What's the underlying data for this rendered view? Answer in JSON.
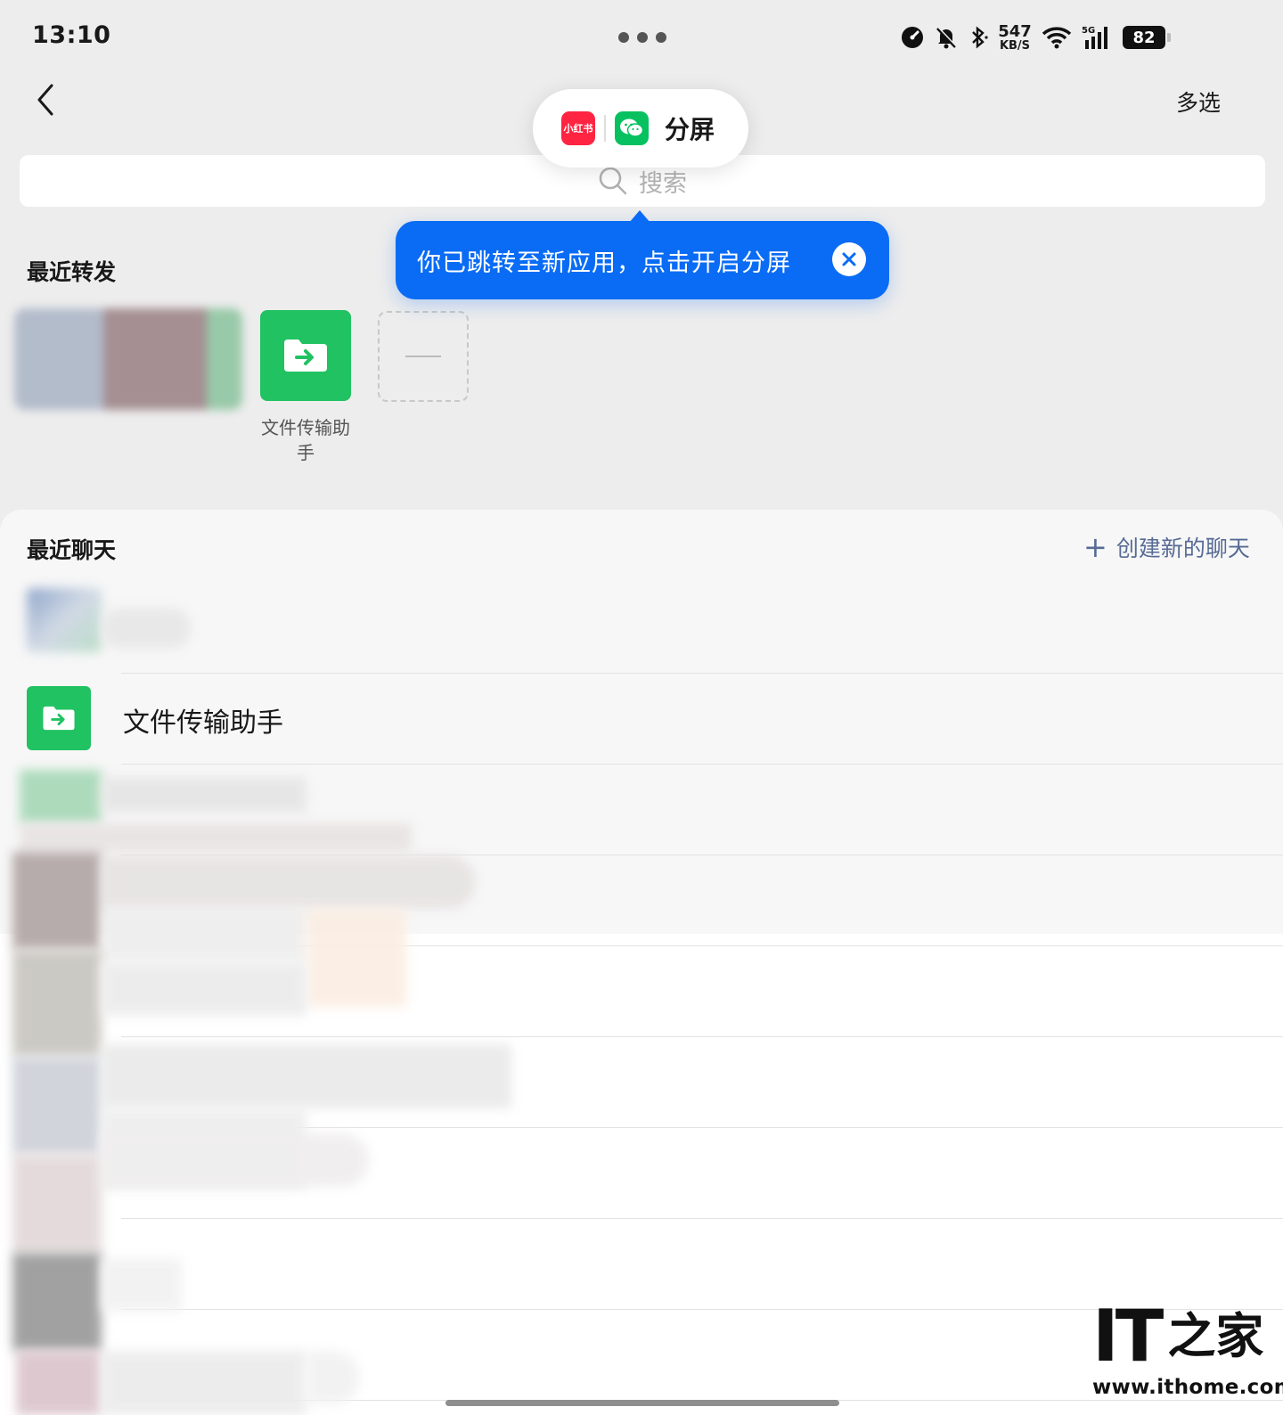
{
  "status_bar": {
    "time": "13:10",
    "net_speed_value": "547",
    "net_speed_unit": "KB/S",
    "network_type": "5G",
    "battery": "82",
    "icons": [
      "speedometer-icon",
      "mute-bell-icon",
      "bluetooth-icon",
      "wifi-icon",
      "signal-icon",
      "battery-icon"
    ]
  },
  "header": {
    "more_dots_icon": "more-dots-icon",
    "back_icon": "chevron-left-icon",
    "multi_select": "多选"
  },
  "split_screen": {
    "app1_label": "小红书",
    "app2_icon": "wechat-icon",
    "label": "分屏"
  },
  "search": {
    "placeholder": "搜索",
    "icon": "search-icon"
  },
  "tooltip": {
    "message": "你已跳转至新应用，点击开启分屏",
    "close_icon": "close-icon"
  },
  "recent_forward": {
    "title": "最近转发",
    "file_helper_label": "文件传输助手",
    "more_icon": "dash-icon"
  },
  "recent_chats": {
    "title": "最近聊天",
    "create_label": "创建新的聊天",
    "create_icon": "plus-icon",
    "file_helper_name": "文件传输助手"
  },
  "watermark": {
    "logo_latin": "IT",
    "logo_cjk": "之家",
    "url": "www.ithome.com"
  },
  "colors": {
    "accent_blue": "#0a6cf5",
    "wechat_green": "#20c261",
    "xiaohongshu_red": "#ff2442",
    "link_blue": "#576b95",
    "background": "#ededed"
  }
}
